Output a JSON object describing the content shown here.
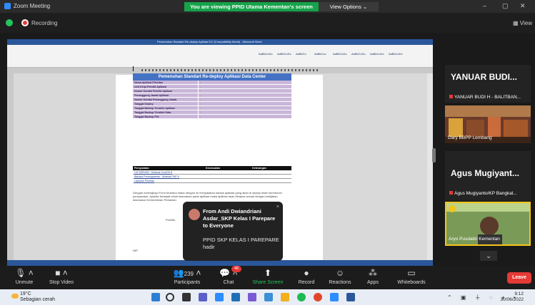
{
  "window": {
    "app_title": "Zoom Meeting",
    "share_banner": "You are viewing PPID Utama Kementan's screen",
    "view_options": "View Options ⌄",
    "minimize": "–",
    "maximize": "▢",
    "close": "✕"
  },
  "status": {
    "recording_label": "Recording",
    "view_label": "▦ View"
  },
  "shared_doc": {
    "window_title": "Pemenuhan Standart Re-deploy Aplikasi DC [Compatibility Mode] - Microsoft Word",
    "ribbon_styles": [
      "AaBbCcDc",
      "AaBbCcDc",
      "AaBbCc",
      "AaBbCcc",
      "AaBbCcDc",
      "AaBbCcDc",
      "AaBbCcDc",
      "AaBbCcDc"
    ],
    "table_title": "Pemenuhan Standart Re-deploy Aplikasi Data Center",
    "fields": [
      {
        "label": "Nama Aplikasi Prioritas",
        "value": ":"
      },
      {
        "label": "Unit Kerja Pemilik Aplikasi",
        "value": ":"
      },
      {
        "label": "Nomor Kontak Pemilik Aplikasi",
        "value": ":"
      },
      {
        "label": "Penanggung Jawab Aplikasi",
        "value": ":"
      },
      {
        "label": "Nomor Kontak Penanggung Jawab",
        "value": ":"
      },
      {
        "label": "Tanggal Deploy",
        "value": ":"
      },
      {
        "label": "Tanggal Backup Terakhir Aplikasi",
        "value": ":"
      },
      {
        "label": "Tanggal Backup Terakhir Data",
        "value": ":"
      },
      {
        "label": "Tanggal Backup File",
        "value": ":"
      }
    ],
    "req_headers": [
      "Persyaratan",
      "Kesesuaian",
      "Keterangan"
    ],
    "requirements": [
      "OS SERVER : Minimal CentOS 8",
      "Bahasa Pemrograman : Minimal PHP 8",
      "Layanan Prioritas"
    ],
    "paragraph": "Dengan melengkapi Form tersebut maka dengan ini menyatakan bahwa aplikasi yang akan di deploy telah memenuhi persyaratan. Apabila terdapat celah keamanan pada aplikasi maka aplikasi akan dihapus sesuai dengan kebijakan keamanan Kementerian Pertanian",
    "sign_note": "Pemilik,",
    "nip": "NIP."
  },
  "chat_toast": {
    "from": "From Andi Dwiandriani Asdar_SKP Kelas I Parepare to Everyone",
    "message": "PPID SKP KELAS I PAREPARE hadir",
    "close": "×"
  },
  "participants_gallery": [
    {
      "display_name": "YANUAR BUDI...",
      "full_name": "YANUAR BUDI H - BALITBAN..."
    },
    {
      "video_label": "Dary BBPP Lembang"
    },
    {
      "display_name": "Agus Mugiyant...",
      "full_name": "Agus Mugiyanto/KP Bangkal..."
    },
    {
      "video_label": "Aryo Pusdatin Kementan"
    }
  ],
  "toolbar": {
    "unmute": "Unmute",
    "stop_video": "Stop Video",
    "participants": "Participants",
    "participants_count": "239",
    "chat": "Chat",
    "chat_badge": "46",
    "share_screen": "Share Screen",
    "record": "Record",
    "reactions": "Reactions",
    "apps": "Apps",
    "whiteboards": "Whiteboards",
    "leave": "Leave"
  },
  "taskbar": {
    "temperature": "19°C",
    "weather": "Sebagian cerah",
    "time": "9:12",
    "date": "30/06/2022"
  },
  "colors": {
    "share_banner": "#16a34a",
    "leave": "#e53935",
    "table_header": "#4472c4",
    "table_row": "#c9b6d9",
    "active_speaker_border": "#f5c518"
  }
}
